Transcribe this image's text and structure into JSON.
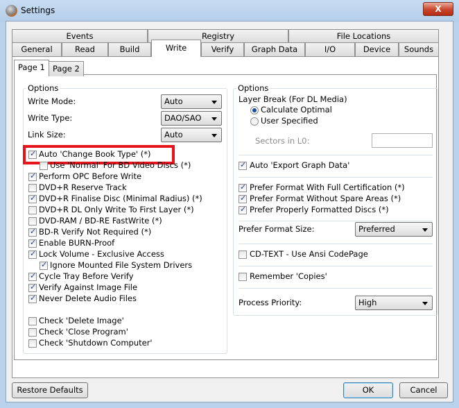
{
  "window": {
    "title": "Settings",
    "close": "X"
  },
  "tabs_row1": [
    "Events",
    "Registry",
    "File Locations"
  ],
  "tabs_row2": [
    "General",
    "Read",
    "Build",
    "Write",
    "Verify",
    "Graph Data",
    "I/O",
    "Device",
    "Sounds"
  ],
  "active_tab": "Write",
  "page_tabs": [
    "Page 1",
    "Page 2"
  ],
  "left": {
    "group_label": "Options",
    "write_mode": {
      "label": "Write Mode:",
      "value": "Auto"
    },
    "write_type": {
      "label": "Write Type:",
      "value": "DAO/SAO"
    },
    "link_size": {
      "label": "Link Size:",
      "value": "Auto"
    },
    "checks": [
      {
        "label": "Auto 'Change Book Type' (*)",
        "checked": true
      },
      {
        "label": "Use 'Normal' For BD Video Discs (*)",
        "checked": false
      },
      {
        "label": "Perform OPC Before Write",
        "checked": true
      },
      {
        "label": "DVD+R Reserve Track",
        "checked": false
      },
      {
        "label": "DVD+R Finalise Disc (Minimal Radius) (*)",
        "checked": true
      },
      {
        "label": "DVD+R DL Only Write To First Layer (*)",
        "checked": false
      },
      {
        "label": "DVD-RAM / BD-RE FastWrite (*)",
        "checked": false
      },
      {
        "label": "BD-R Verify Not Required (*)",
        "checked": true
      },
      {
        "label": "Enable BURN-Proof",
        "checked": true
      },
      {
        "label": "Lock Volume - Exclusive Access",
        "checked": true
      },
      {
        "label": "Ignore Mounted File System Drivers",
        "checked": true
      },
      {
        "label": "Cycle Tray Before Verify",
        "checked": true
      },
      {
        "label": "Verify Against Image File",
        "checked": true
      },
      {
        "label": "Never Delete Audio Files",
        "checked": true
      },
      {
        "label": "Check 'Delete Image'",
        "checked": false
      },
      {
        "label": "Check 'Close Program'",
        "checked": false
      },
      {
        "label": "Check 'Shutdown Computer'",
        "checked": false
      }
    ]
  },
  "right": {
    "group_label": "Options",
    "layer_break_label": "Layer Break (For DL Media)",
    "radios": [
      {
        "label": "Calculate Optimal",
        "selected": true
      },
      {
        "label": "User Specified",
        "selected": false
      }
    ],
    "sectors_label": "Sectors in L0:",
    "sectors_value": "",
    "checks": [
      {
        "label": "Auto 'Export Graph Data'",
        "checked": true
      },
      {
        "label": "Prefer Format With Full Certification (*)",
        "checked": true
      },
      {
        "label": "Prefer Format Without Spare Areas (*)",
        "checked": true
      },
      {
        "label": "Prefer Properly Formatted Discs (*)",
        "checked": true
      },
      {
        "label": "CD-TEXT - Use Ansi CodePage",
        "checked": false
      },
      {
        "label": "Remember 'Copies'",
        "checked": false
      }
    ],
    "format_size": {
      "label": "Prefer Format Size:",
      "value": "Preferred"
    },
    "priority": {
      "label": "Process Priority:",
      "value": "High"
    }
  },
  "buttons": {
    "restore": "Restore Defaults",
    "ok": "OK",
    "cancel": "Cancel"
  },
  "highlight_color": "#e8141c"
}
